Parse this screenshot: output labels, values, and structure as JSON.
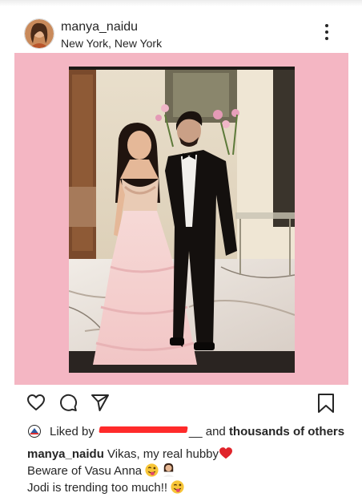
{
  "post": {
    "username": "manya_naidu",
    "location": "New York, New York",
    "liked_prefix": "Liked by",
    "liked_user_redacted": "__",
    "liked_connector": "and",
    "liked_others": "thousands of others",
    "caption": {
      "username": "manya_naidu",
      "line1": "Vikas, my real hubby",
      "line2": "Beware of Vasu Anna",
      "line3": "Jodi is trending too much!!"
    }
  },
  "colors": {
    "post_background": "#f4b6c3",
    "heart": "#e0242b",
    "redaction": "#ff2a2a"
  },
  "icons": [
    "more-options-icon",
    "like-heart-icon",
    "comment-icon",
    "share-icon",
    "save-bookmark-icon",
    "liked-by-avatar-icon",
    "red-heart-emoji",
    "winking-tongue-emoji",
    "woman-shrugging-emoji",
    "winking-face-emoji"
  ]
}
